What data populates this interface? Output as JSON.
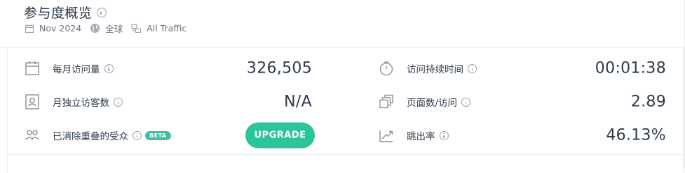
{
  "header": {
    "title": "参与度概览",
    "date": "Nov 2024",
    "region": "全球",
    "traffic": "All Traffic"
  },
  "metrics": {
    "monthly_visits": {
      "label": "每月访问量",
      "value": "326,505"
    },
    "unique_visitors": {
      "label": "月独立访客数",
      "value": "N/A"
    },
    "deduplicated_audience": {
      "label": "已消除重叠的受众",
      "badge": "BETA",
      "button": "UPGRADE"
    },
    "visit_duration": {
      "label": "访问持续时间",
      "value": "00:01:38"
    },
    "pages_per_visit": {
      "label": "页面数/访问",
      "value": "2.89"
    },
    "bounce_rate": {
      "label": "跳出率",
      "value": "46.13%"
    }
  },
  "colors": {
    "accent": "#2cc59b",
    "badge": "#3fc0a0",
    "text": "#2e3a4a",
    "muted": "#9aa1aa"
  }
}
